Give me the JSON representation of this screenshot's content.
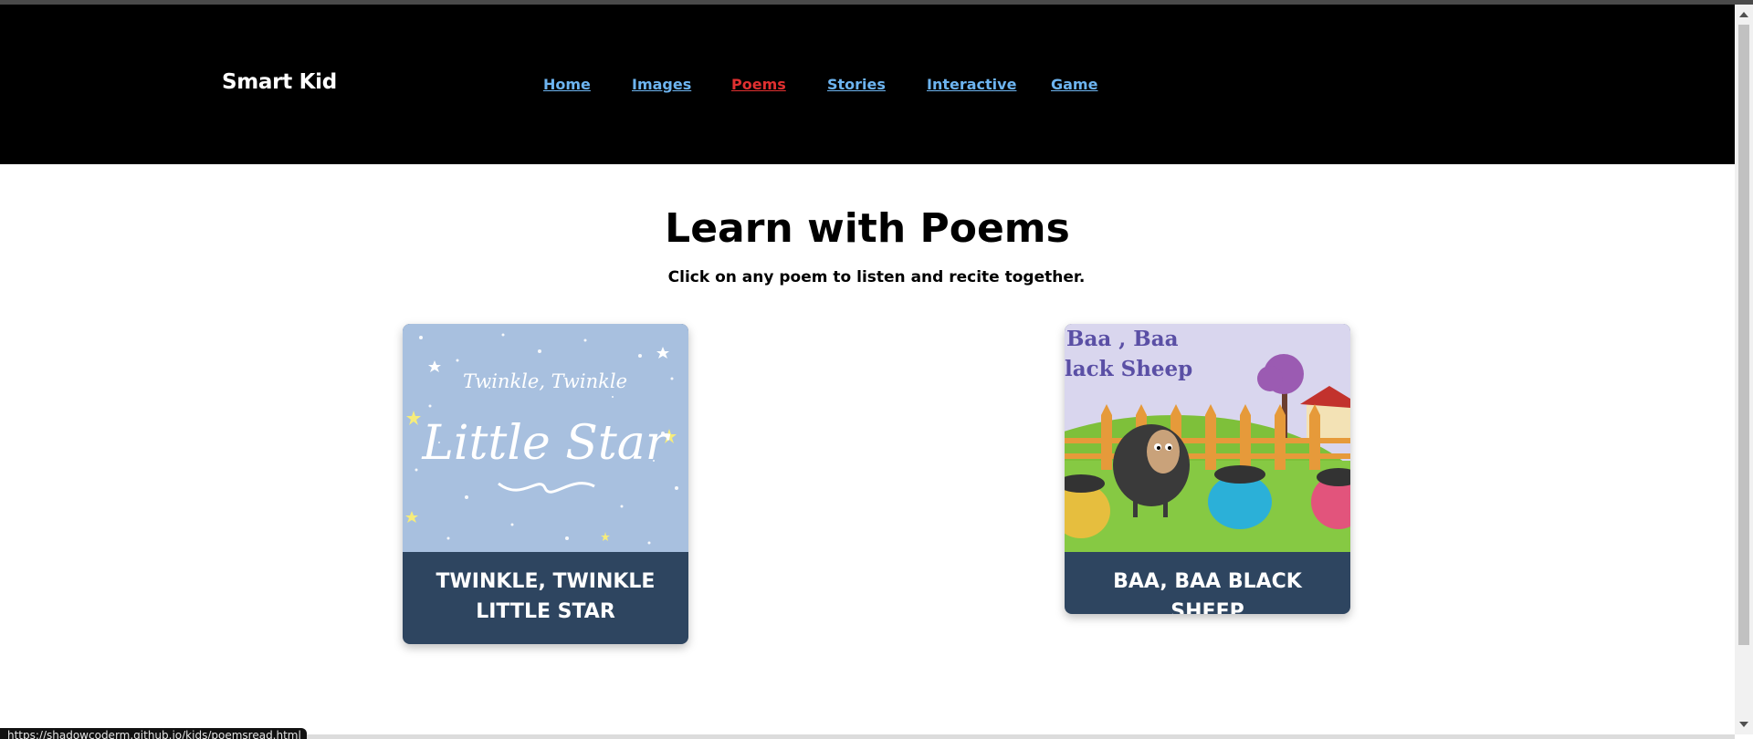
{
  "header": {
    "brand": "Smart Kid",
    "nav": [
      {
        "label": "Home",
        "active": false
      },
      {
        "label": "Images",
        "active": false
      },
      {
        "label": "Poems",
        "active": true
      },
      {
        "label": "Stories",
        "active": false
      },
      {
        "label": "Interactive",
        "active": false
      },
      {
        "label": "Game",
        "active": false
      }
    ]
  },
  "main": {
    "title": "Learn with Poems",
    "subtitle": "Click on any poem to listen and recite together.",
    "cards": [
      {
        "title": "TWINKLE, TWINKLE LITTLE STAR",
        "image_text_top": "Twinkle, Twinkle",
        "image_text_main": "Little Star"
      },
      {
        "title": "BAA, BAA BLACK SHEEP",
        "image_text_line1": "Baa , Baa",
        "image_text_line2": "lack Sheep"
      }
    ]
  },
  "status_bar": {
    "url": "https://shadowcoderm.github.io/kids/poemsread.html"
  },
  "colors": {
    "header_bg": "#000000",
    "nav_link": "#6db4f0",
    "nav_active": "#e03030",
    "card_bg": "#2e4560"
  }
}
